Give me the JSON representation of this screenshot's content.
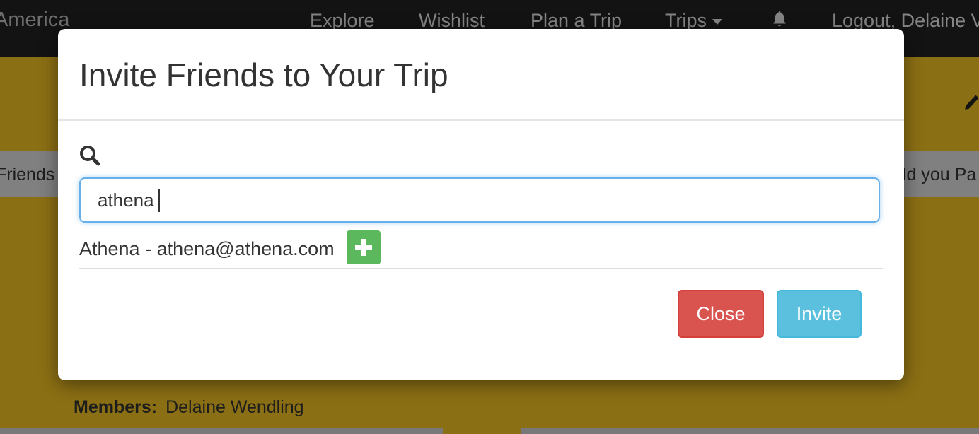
{
  "navbar": {
    "brand": "America",
    "items": [
      "Explore",
      "Wishlist",
      "Plan a Trip",
      "Trips",
      "Logout, Delaine V"
    ]
  },
  "background_page": {
    "tab_left": "Friends",
    "tab_right": "ld you Pa",
    "members_label": "Members:",
    "members_value": "Delaine Wendling"
  },
  "modal": {
    "title": "Invite Friends to Your Trip",
    "search": {
      "value": "athena"
    },
    "results": [
      {
        "text": "Athena - athena@athena.com"
      }
    ],
    "buttons": {
      "close": "Close",
      "invite": "Invite"
    }
  },
  "colors": {
    "navbar": "#222222",
    "page_band": "#efbf24",
    "close_button": "#d9534f",
    "invite_button": "#5bc0de",
    "add_button": "#5cb85c",
    "input_focus": "#66afe9"
  },
  "icons": {
    "search": "search-icon",
    "bell": "bell-icon",
    "add": "plus-icon",
    "edit": "pencil-icon",
    "dropdown": "caret-down-icon"
  }
}
